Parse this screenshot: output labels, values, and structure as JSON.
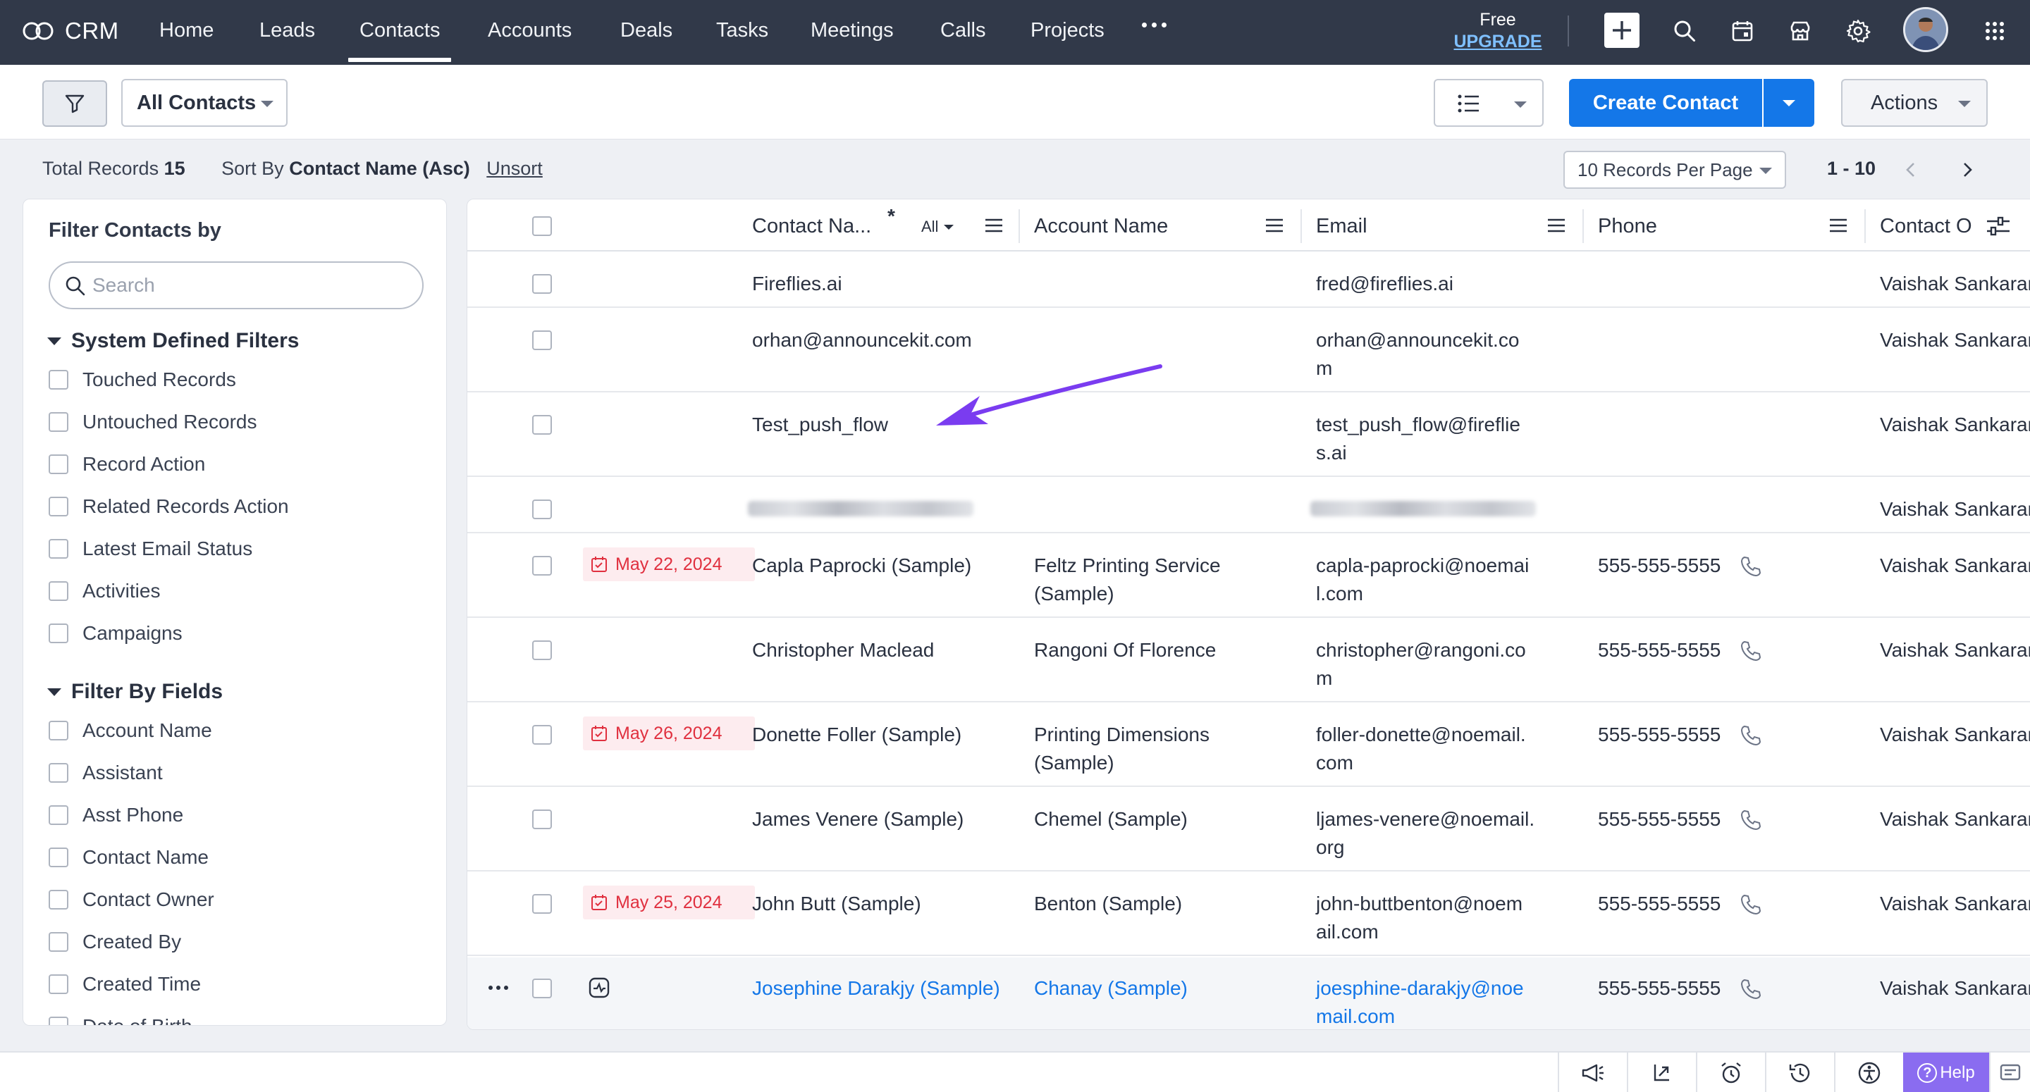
{
  "app": {
    "name": "CRM"
  },
  "nav": {
    "tabs": [
      "Home",
      "Leads",
      "Contacts",
      "Accounts",
      "Deals",
      "Tasks",
      "Meetings",
      "Calls",
      "Projects"
    ],
    "active_tab": "Contacts",
    "plan_label": "Free",
    "upgrade_label": "UPGRADE"
  },
  "toolbar": {
    "view_select": "All Contacts",
    "create_label": "Create Contact",
    "actions_label": "Actions"
  },
  "records_bar": {
    "total_label": "Total Records",
    "total_value": "15",
    "sort_label": "Sort By",
    "sort_value": "Contact Name (Asc)",
    "unsort_label": "Unsort",
    "per_page": "10 Records Per Page",
    "page_range": "1 - 10"
  },
  "sidebar": {
    "title": "Filter Contacts by",
    "search_placeholder": "Search",
    "system_filters_title": "System Defined Filters",
    "system_filters": [
      "Touched Records",
      "Untouched Records",
      "Record Action",
      "Related Records Action",
      "Latest Email Status",
      "Activities",
      "Campaigns"
    ],
    "field_filters_title": "Filter By Fields",
    "field_filters": [
      "Account Name",
      "Assistant",
      "Asst Phone",
      "Contact Name",
      "Contact Owner",
      "Created By",
      "Created Time",
      "Date of Birth"
    ]
  },
  "table": {
    "columns": {
      "contact_name": "Contact Na...",
      "contact_name_filter": "All",
      "account_name": "Account Name",
      "email": "Email",
      "phone": "Phone",
      "owner": "Contact O"
    },
    "rows": [
      {
        "date": "",
        "name": "Fireflies.ai",
        "account": "",
        "email": [
          "fred@fireflies.ai"
        ],
        "phone": "",
        "owner": "Vaishak Sankaran"
      },
      {
        "date": "",
        "name": "orhan@announcekit.com",
        "account": "",
        "email": [
          "orhan@announcekit.co",
          "m"
        ],
        "phone": "",
        "owner": "Vaishak Sankaran"
      },
      {
        "date": "",
        "name": "Test_push_flow",
        "account": "",
        "email": [
          "test_push_flow@fireflie",
          "s.ai"
        ],
        "phone": "",
        "owner": "Vaishak Sankaran"
      },
      {
        "date": "",
        "name": "",
        "account": "",
        "email": [
          ""
        ],
        "phone": "",
        "owner": "Vaishak Sankaran",
        "redacted": true
      },
      {
        "date": "May 22, 2024",
        "name": "Capla Paprocki (Sample)",
        "account": [
          "Feltz Printing Service",
          "(Sample)"
        ],
        "email": [
          "capla-paprocki@noemai",
          "l.com"
        ],
        "phone": "555-555-5555",
        "owner": "Vaishak Sankaran"
      },
      {
        "date": "",
        "name": "Christopher Maclead",
        "account": [
          "Rangoni Of Florence"
        ],
        "email": [
          "christopher@rangoni.co",
          "m"
        ],
        "phone": "555-555-5555",
        "owner": "Vaishak Sankaran"
      },
      {
        "date": "May 26, 2024",
        "name": "Donette Foller (Sample)",
        "account": [
          "Printing Dimensions",
          "(Sample)"
        ],
        "email": [
          "foller-donette@noemail.",
          "com"
        ],
        "phone": "555-555-5555",
        "owner": "Vaishak Sankaran"
      },
      {
        "date": "",
        "name": "James Venere (Sample)",
        "account": [
          "Chemel (Sample)"
        ],
        "email": [
          "ljames-venere@noemail.",
          "org"
        ],
        "phone": "555-555-5555",
        "owner": "Vaishak Sankaran"
      },
      {
        "date": "May 25, 2024",
        "name": "John Butt (Sample)",
        "account": [
          "Benton (Sample)"
        ],
        "email": [
          "john-buttbenton@noem",
          "ail.com"
        ],
        "phone": "555-555-5555",
        "owner": "Vaishak Sankaran"
      },
      {
        "date": "",
        "name": "Josephine Darakjy (Sample)",
        "account": [
          "Chanay (Sample)"
        ],
        "email": [
          "joesphine-darakjy@noe",
          "mail.com"
        ],
        "phone": "555-555-5555",
        "owner": "Vaishak Sankaran",
        "highlighted": true
      }
    ]
  },
  "bottom_bar": {
    "help_label": "Help"
  },
  "colors": {
    "nav_bg": "#313949",
    "primary": "#1477e8",
    "annotation": "#7a3cf0",
    "date_badge": "#e0303f",
    "help_bg": "#8a6cf0"
  },
  "icons": [
    "crm-logo-icon",
    "plus-icon",
    "search-icon",
    "calendar-icon",
    "store-icon",
    "gear-icon",
    "apps-grid-icon",
    "filter-icon",
    "list-view-icon",
    "chevron-left-icon",
    "chevron-right-icon",
    "column-settings-icon",
    "phone-icon",
    "calendar-check-icon",
    "activity-icon",
    "announcement-icon",
    "export-icon",
    "alarm-icon",
    "history-icon",
    "accessibility-icon",
    "feedback-icon"
  ]
}
